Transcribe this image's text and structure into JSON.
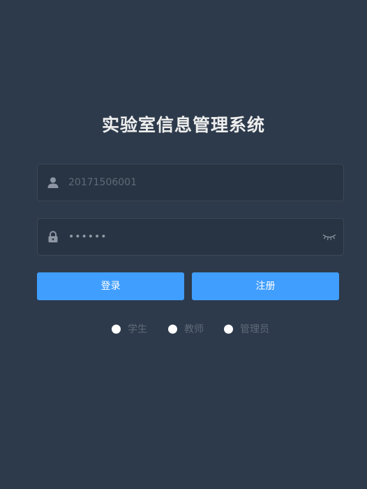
{
  "title": "实验室信息管理系统",
  "username": {
    "value": "20171506001",
    "icon": "user-icon"
  },
  "password": {
    "value": "••••••",
    "icon": "lock-icon",
    "toggle_icon": "eye-closed-icon"
  },
  "buttons": {
    "login": "登录",
    "register": "注册"
  },
  "roles": [
    {
      "label": "学生"
    },
    {
      "label": "教师"
    },
    {
      "label": "管理员"
    }
  ],
  "colors": {
    "background": "#2d3a4b",
    "field_background": "#283443",
    "accent": "#409eff"
  }
}
